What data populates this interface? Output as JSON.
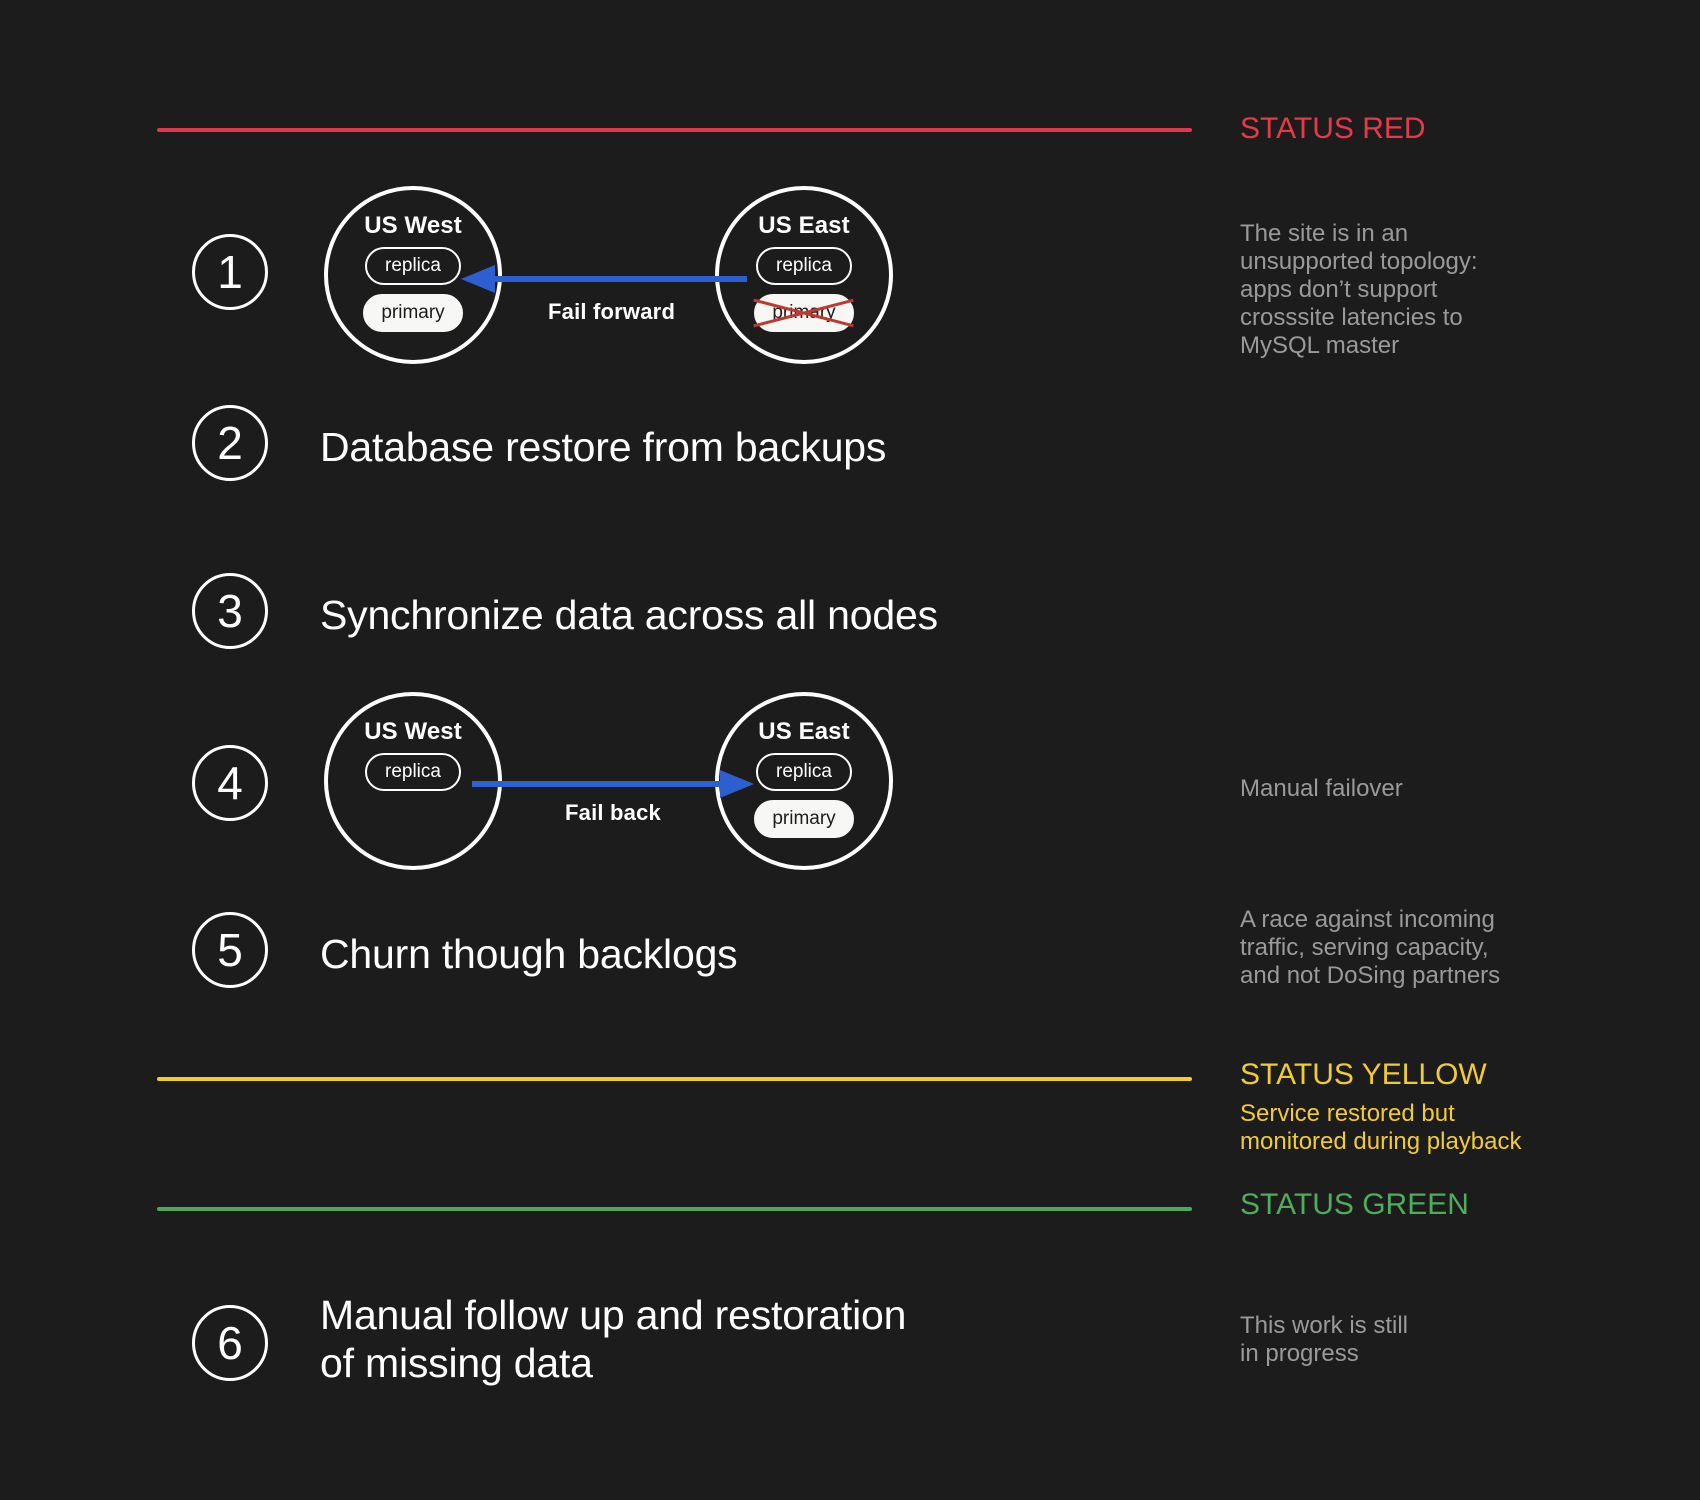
{
  "colors": {
    "background": "#1c1c1c",
    "status_red": "#e8394b",
    "status_yellow": "#f2cb33",
    "status_green": "#4eac5b",
    "arrow_blue": "#2d5fd0",
    "strike_red": "#c0392f",
    "note_gray": "#9a9a9a",
    "white": "#ffffff"
  },
  "steps": [
    {
      "number": "1",
      "title": ""
    },
    {
      "number": "2",
      "title": "Database restore from backups"
    },
    {
      "number": "3",
      "title": "Synchronize data across all nodes"
    },
    {
      "number": "4",
      "title": ""
    },
    {
      "number": "5",
      "title": "Churn though backlogs"
    },
    {
      "number": "6",
      "title": "Manual follow up and restoration\nof missing data"
    }
  ],
  "diagram_step1": {
    "left_region": {
      "name": "US West",
      "pills": [
        {
          "label": "replica",
          "style": "outline",
          "struck": false
        },
        {
          "label": "primary",
          "style": "filled",
          "struck": false
        }
      ]
    },
    "right_region": {
      "name": "US East",
      "pills": [
        {
          "label": "replica",
          "style": "outline",
          "struck": false
        },
        {
          "label": "primary",
          "style": "filled",
          "struck": true
        }
      ]
    },
    "arrow_label": "Fail forward",
    "arrow_direction": "right-to-left"
  },
  "diagram_step4": {
    "left_region": {
      "name": "US West",
      "pills": [
        {
          "label": "replica",
          "style": "outline",
          "struck": false
        }
      ]
    },
    "right_region": {
      "name": "US East",
      "pills": [
        {
          "label": "replica",
          "style": "outline",
          "struck": false
        },
        {
          "label": "primary",
          "style": "filled",
          "struck": false
        }
      ]
    },
    "arrow_label": "Fail back",
    "arrow_direction": "left-to-right"
  },
  "status_sections": {
    "red": {
      "heading": "STATUS RED",
      "note": "The site is in an\nunsupported topology:\napps don’t support\ncrosssite latencies to\nMySQL master"
    },
    "yellow": {
      "heading": "STATUS YELLOW",
      "note": "Service restored but\nmonitored during playback"
    },
    "green": {
      "heading": "STATUS GREEN",
      "note": ""
    }
  },
  "notes": {
    "manual_failover": "Manual failover",
    "race": "A race against incoming\ntraffic, serving capacity,\nand not DoSing partners",
    "work_in_progress": "This work is still\nin progress"
  }
}
